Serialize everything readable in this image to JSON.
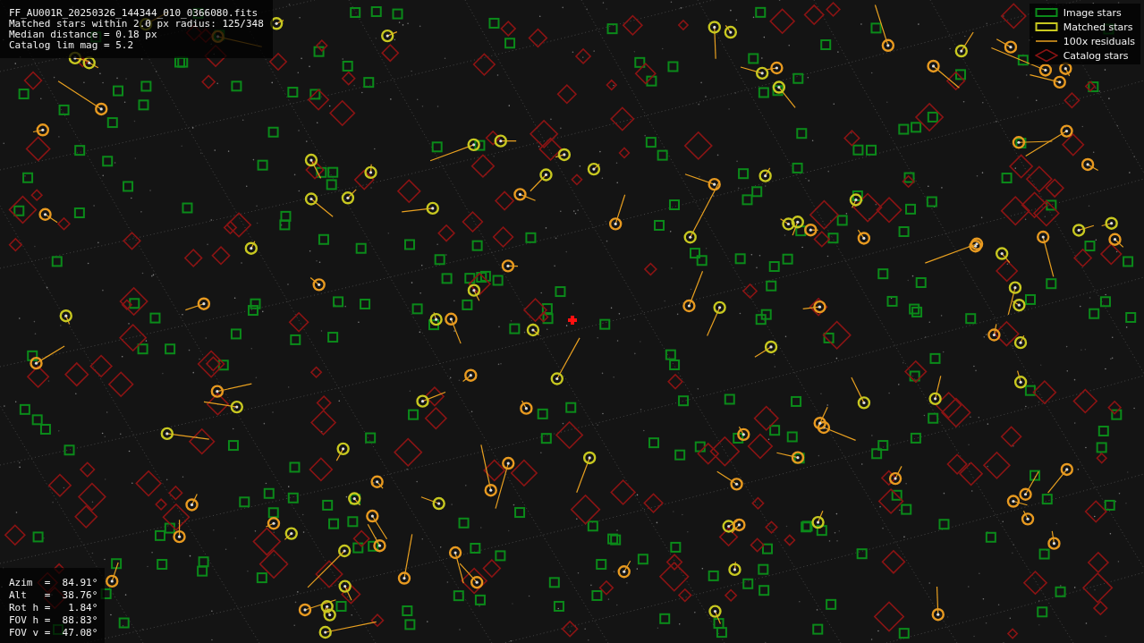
{
  "header": {
    "lines": [
      "FF_AU001R_20250326_144344_010_0366080.fits",
      "Matched stars within 2.0 px radius: 125/348",
      "Median distance = 0.18 px",
      "Catalog lim mag = 5.2"
    ]
  },
  "legend": [
    {
      "kind": "image",
      "label": "Image stars"
    },
    {
      "kind": "matched",
      "label": "Matched stars"
    },
    {
      "kind": "residual",
      "label": "100x residuals"
    },
    {
      "kind": "catalog",
      "label": "Catalog stars"
    }
  ],
  "pointing": {
    "lines": [
      "Azim  =  84.91°",
      "Alt   =  38.76°",
      "Rot h =   1.84°",
      "FOV h =  88.83°",
      "FOV v =  47.08°"
    ]
  }
}
